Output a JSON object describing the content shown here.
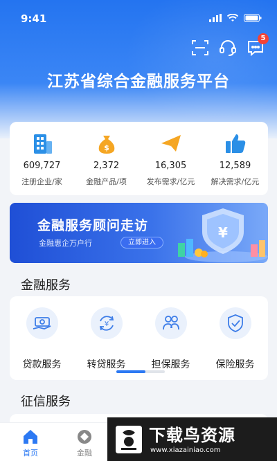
{
  "status_bar": {
    "time": "9:41"
  },
  "header": {
    "title": "江苏省综合金融服务平台",
    "message_badge": "5",
    "icons": [
      "scan-icon",
      "headset-icon",
      "message-icon"
    ]
  },
  "stats": [
    {
      "value": "609,727",
      "label": "注册企业/家",
      "icon": "building-icon",
      "color": "#2b8fe6"
    },
    {
      "value": "2,372",
      "label": "金融产品/项",
      "icon": "money-bag-icon",
      "color": "#f5a623"
    },
    {
      "value": "16,305",
      "label": "发布需求/亿元",
      "icon": "paper-plane-icon",
      "color": "#f5a623"
    },
    {
      "value": "12,589",
      "label": "解决需求/亿元",
      "icon": "thumbs-up-icon",
      "color": "#2b8fe6"
    }
  ],
  "banner": {
    "title": "金融服务顾问走访",
    "subtitle": "金融惠企万户行",
    "button": "立即进入"
  },
  "financial_services": {
    "title": "金融服务",
    "items": [
      {
        "label": "贷款服务",
        "icon": "loan-icon"
      },
      {
        "label": "转贷服务",
        "icon": "refinance-icon"
      },
      {
        "label": "担保服务",
        "icon": "guarantee-icon"
      },
      {
        "label": "保险服务",
        "icon": "insurance-icon"
      }
    ],
    "page_progress": 0.6
  },
  "credit_services": {
    "title": "征信服务"
  },
  "tabbar": {
    "items": [
      {
        "label": "首页",
        "icon": "home-icon",
        "active": true
      },
      {
        "label": "金融",
        "icon": "finance-icon",
        "active": false
      }
    ],
    "active_color": "#2c79f3",
    "inactive_color": "#888888"
  },
  "watermark": {
    "title": "下载鸟资源",
    "url": "www.xiazainiao.com"
  }
}
